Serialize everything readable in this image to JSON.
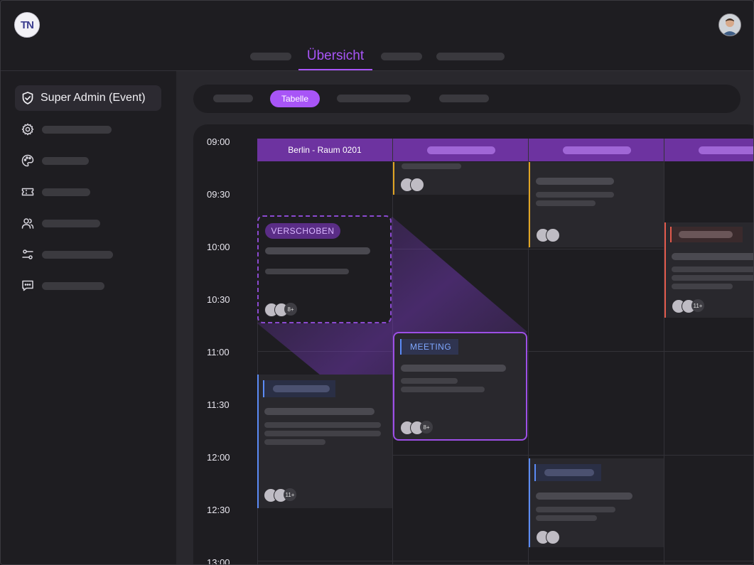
{
  "app": {
    "logo_text": "TN"
  },
  "header": {
    "tabs": [
      {
        "label": "",
        "active": false
      },
      {
        "label": "Übersicht",
        "active": true
      },
      {
        "label": "",
        "active": false
      },
      {
        "label": "",
        "active": false
      }
    ]
  },
  "sidebar": {
    "items": [
      {
        "label": "Super Admin (Event)",
        "icon": "shield-check-icon",
        "active": true
      },
      {
        "label": "",
        "icon": "gear-icon"
      },
      {
        "label": "",
        "icon": "palette-icon"
      },
      {
        "label": "",
        "icon": "ticket-icon"
      },
      {
        "label": "",
        "icon": "users-icon"
      },
      {
        "label": "",
        "icon": "sliders-icon"
      },
      {
        "label": "",
        "icon": "chat-icon"
      }
    ]
  },
  "subnav": {
    "active_label": "Tabelle"
  },
  "calendar": {
    "times": [
      "09:00",
      "09:30",
      "10:00",
      "10:30",
      "11:00",
      "11:30",
      "12:00",
      "12:30",
      "13:00"
    ],
    "columns": [
      {
        "label": "Berlin - Raum 0201"
      },
      {
        "label": ""
      },
      {
        "label": ""
      },
      {
        "label": ""
      }
    ],
    "events": {
      "postponed": {
        "badge": "VERSCHOBEN",
        "more_count": "8+"
      },
      "meeting": {
        "label": "MEETING",
        "more_count": "8+"
      },
      "blue_left": {
        "more_count": "11+"
      },
      "red_right": {
        "more_count": "11+"
      }
    }
  },
  "colors": {
    "accent": "#a855f7",
    "column_header": "#6d33a0",
    "postponed_badge": "#5a2d86",
    "meeting_accent": "#5b8bf7",
    "yellow_accent": "#e0a423",
    "red_accent": "#e25a4c"
  }
}
